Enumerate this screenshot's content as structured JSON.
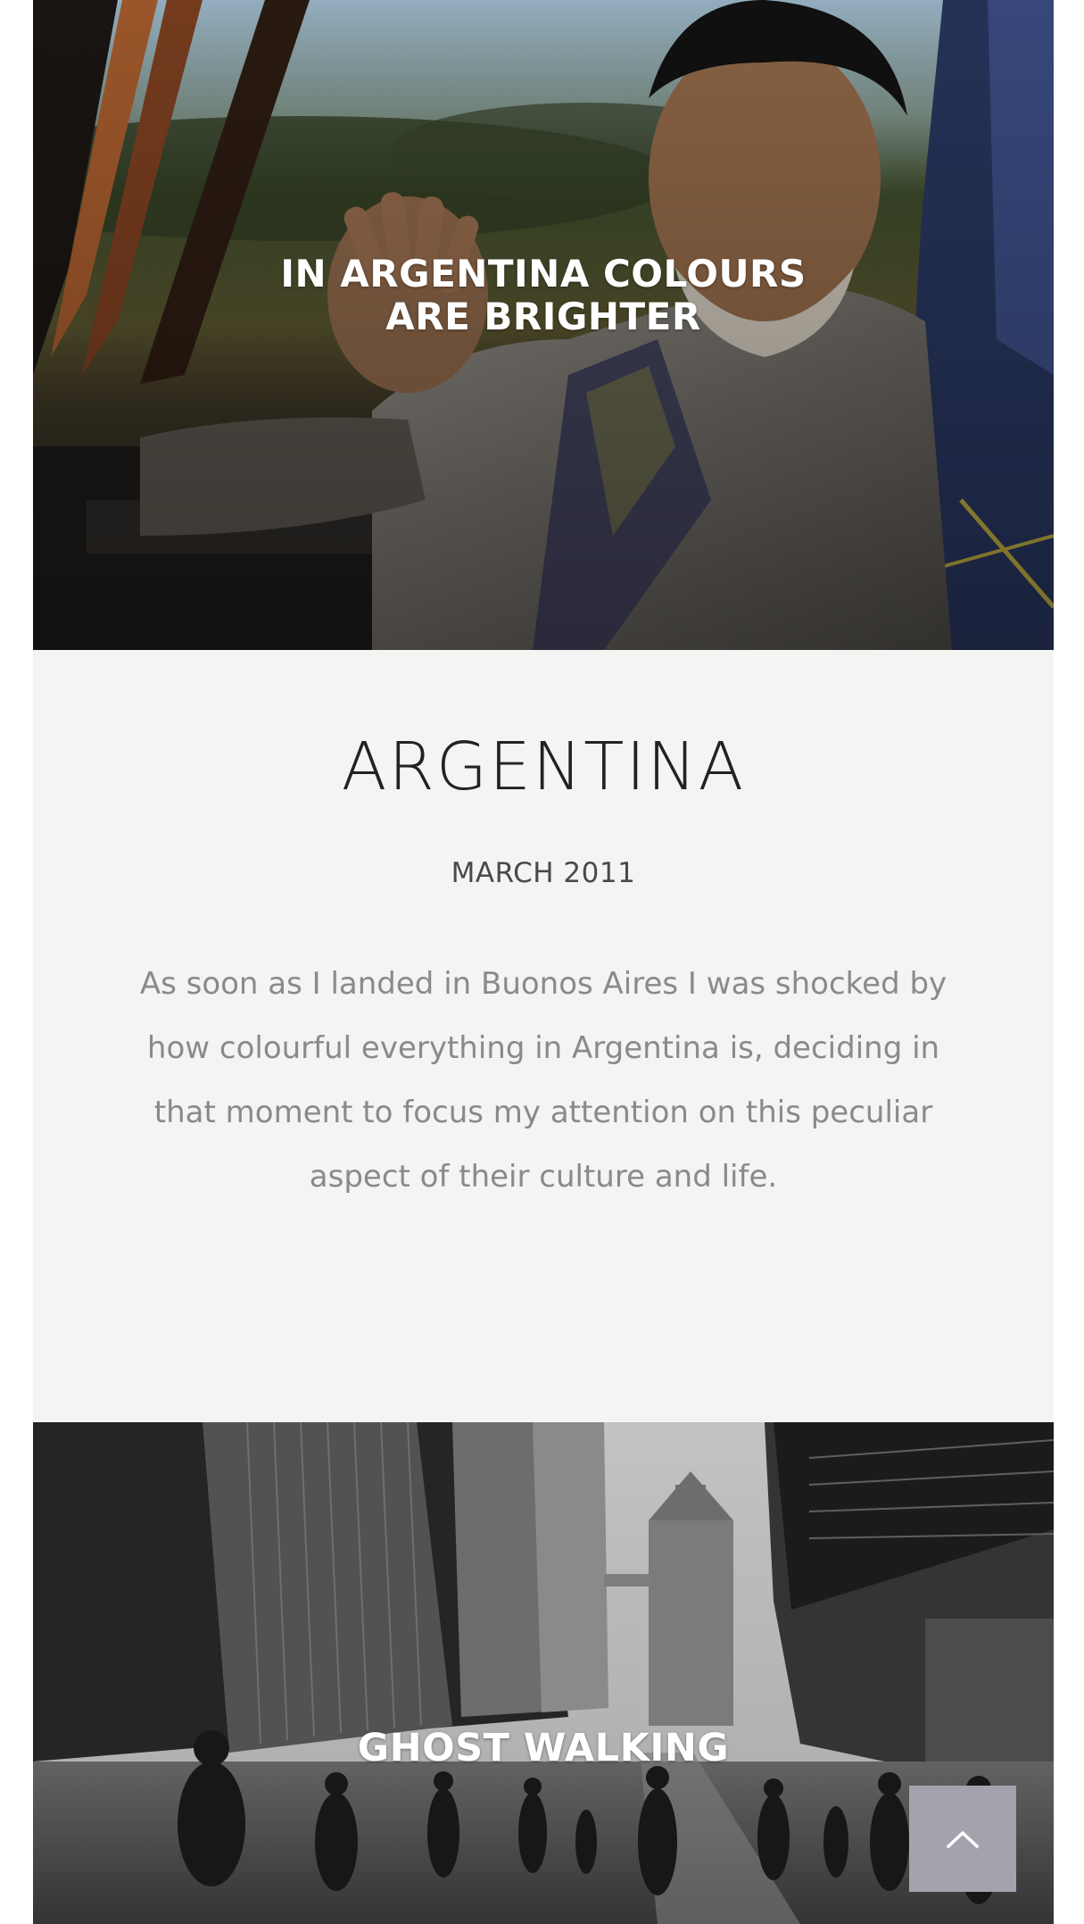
{
  "hero": {
    "title_line1": "IN ARGENTINA COLOURS",
    "title_line2": "ARE BRIGHTER",
    "image_icon": "photo-man-waving-in-car"
  },
  "article": {
    "title": "ARGENTINA",
    "date": "MARCH 2011",
    "body": "As soon as I landed in Buonos Aires I was shocked by how colourful everything in Argentina is, deciding in that moment to focus my attention on this peculiar aspect of their culture and life."
  },
  "next_post": {
    "title": "GHOST WALKING",
    "image_icon": "photo-london-street-tower-bridge"
  },
  "back_to_top": {
    "icon": "chevron-up-icon"
  },
  "colors": {
    "article_bg": "#f4f4f2",
    "back_to_top_bg": "#a3a3ae",
    "title_text": "#222222",
    "body_text": "#8a8a8a"
  }
}
